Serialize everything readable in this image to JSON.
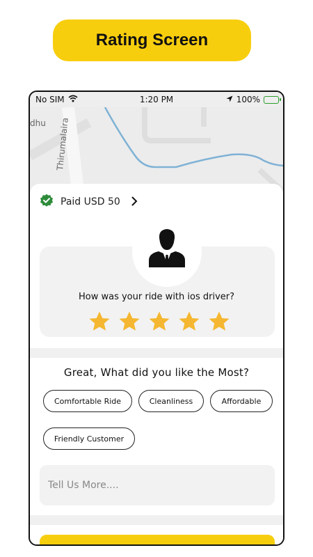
{
  "banner": {
    "title": "Rating Screen"
  },
  "status_bar": {
    "carrier": "No SIM",
    "time": "1:20 PM",
    "battery": "100%"
  },
  "map": {
    "labels": [
      "dhu",
      "Thirumalaira"
    ]
  },
  "payment": {
    "label": "Paid USD 50"
  },
  "rating": {
    "question": "How was your ride with ios driver?",
    "stars": 5,
    "max_stars": 5
  },
  "feedback": {
    "title": "Great, What did you like the Most?",
    "chips": [
      "Comfortable Ride",
      "Cleanliness",
      "Affordable",
      "Friendly Customer"
    ],
    "placeholder": "Tell Us More...."
  },
  "colors": {
    "accent": "#F7CE0E",
    "star": "#F5B731",
    "verified": "#2E8B3A",
    "route": "#7FB2D5"
  }
}
